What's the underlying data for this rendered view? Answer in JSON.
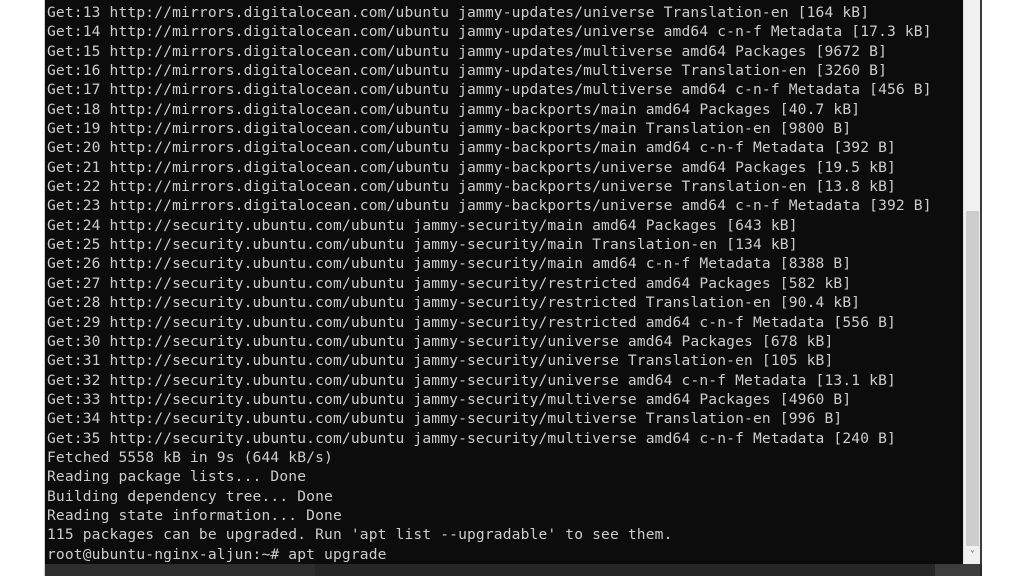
{
  "terminal": {
    "lines": [
      "Get:13 http://mirrors.digitalocean.com/ubuntu jammy-updates/universe Translation-en [164 kB]",
      "Get:14 http://mirrors.digitalocean.com/ubuntu jammy-updates/universe amd64 c-n-f Metadata [17.3 kB]",
      "Get:15 http://mirrors.digitalocean.com/ubuntu jammy-updates/multiverse amd64 Packages [9672 B]",
      "Get:16 http://mirrors.digitalocean.com/ubuntu jammy-updates/multiverse Translation-en [3260 B]",
      "Get:17 http://mirrors.digitalocean.com/ubuntu jammy-updates/multiverse amd64 c-n-f Metadata [456 B]",
      "Get:18 http://mirrors.digitalocean.com/ubuntu jammy-backports/main amd64 Packages [40.7 kB]",
      "Get:19 http://mirrors.digitalocean.com/ubuntu jammy-backports/main Translation-en [9800 B]",
      "Get:20 http://mirrors.digitalocean.com/ubuntu jammy-backports/main amd64 c-n-f Metadata [392 B]",
      "Get:21 http://mirrors.digitalocean.com/ubuntu jammy-backports/universe amd64 Packages [19.5 kB]",
      "Get:22 http://mirrors.digitalocean.com/ubuntu jammy-backports/universe Translation-en [13.8 kB]",
      "Get:23 http://mirrors.digitalocean.com/ubuntu jammy-backports/universe amd64 c-n-f Metadata [392 B]",
      "Get:24 http://security.ubuntu.com/ubuntu jammy-security/main amd64 Packages [643 kB]",
      "Get:25 http://security.ubuntu.com/ubuntu jammy-security/main Translation-en [134 kB]",
      "Get:26 http://security.ubuntu.com/ubuntu jammy-security/main amd64 c-n-f Metadata [8388 B]",
      "Get:27 http://security.ubuntu.com/ubuntu jammy-security/restricted amd64 Packages [582 kB]",
      "Get:28 http://security.ubuntu.com/ubuntu jammy-security/restricted Translation-en [90.4 kB]",
      "Get:29 http://security.ubuntu.com/ubuntu jammy-security/restricted amd64 c-n-f Metadata [556 B]",
      "Get:30 http://security.ubuntu.com/ubuntu jammy-security/universe amd64 Packages [678 kB]",
      "Get:31 http://security.ubuntu.com/ubuntu jammy-security/universe Translation-en [105 kB]",
      "Get:32 http://security.ubuntu.com/ubuntu jammy-security/universe amd64 c-n-f Metadata [13.1 kB]",
      "Get:33 http://security.ubuntu.com/ubuntu jammy-security/multiverse amd64 Packages [4960 B]",
      "Get:34 http://security.ubuntu.com/ubuntu jammy-security/multiverse Translation-en [996 B]",
      "Get:35 http://security.ubuntu.com/ubuntu jammy-security/multiverse amd64 c-n-f Metadata [240 B]",
      "Fetched 5558 kB in 9s (644 kB/s)",
      "Reading package lists... Done",
      "Building dependency tree... Done",
      "Reading state information... Done",
      "115 packages can be upgraded. Run 'apt list --upgradable' to see them."
    ],
    "prompt": "root@ubuntu-nginx-aljun:~# ",
    "command": "apt upgrade"
  },
  "scrollbar": {
    "down_arrow_icon": "˅"
  },
  "colors": {
    "background": "#0c0c0c",
    "text": "#cccccc",
    "scrollbar_track": "#f0f0f0",
    "scrollbar_thumb": "#cdcdcd"
  }
}
